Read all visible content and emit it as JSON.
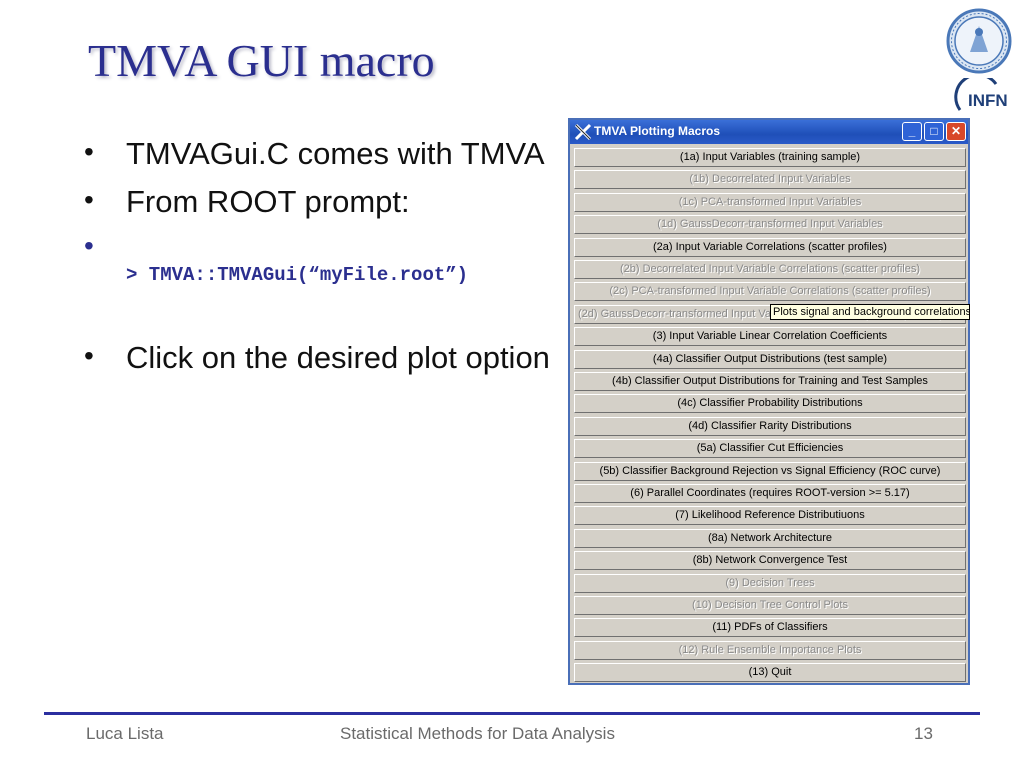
{
  "slide": {
    "title": "TMVA GUI macro",
    "bullets": [
      {
        "mark": "•",
        "text": "TMVAGui.C comes with TMVA"
      },
      {
        "mark": "•",
        "text": "From ROOT prompt:"
      },
      {
        "mark": "•",
        "text": ""
      },
      {
        "mark": "•",
        "text": "Click on the desired plot option"
      }
    ],
    "command": "> TMVA::TMVAGui(“myFile.root”)"
  },
  "logos": {
    "unina": "university-seal",
    "infn": "INFN"
  },
  "window": {
    "title": "TMVA Plotting Macros",
    "controls": {
      "minimize": "_",
      "maximize": "□",
      "close": "✕"
    },
    "buttons": [
      {
        "label": "(1a) Input Variables (training sample)",
        "enabled": true
      },
      {
        "label": "(1b) Decorrelated Input Variables",
        "enabled": false
      },
      {
        "label": "(1c) PCA-transformed Input Variables",
        "enabled": false
      },
      {
        "label": "(1d) GaussDecorr-transformed Input Variables",
        "enabled": false
      },
      {
        "label": "(2a) Input Variable Correlations (scatter profiles)",
        "enabled": true
      },
      {
        "label": "(2b) Decorrelated Input Variable Correlations (scatter profiles)",
        "enabled": false
      },
      {
        "label": "(2c) PCA-transformed Input Variable Correlations (scatter profiles)",
        "enabled": false
      },
      {
        "label": "(2d) GaussDecorr-transformed Input Variable Correlations (scatter profiles)",
        "enabled": false
      },
      {
        "label": "(3) Input Variable Linear Correlation Coefficients",
        "enabled": true
      },
      {
        "label": "(4a) Classifier Output Distributions (test sample)",
        "enabled": true
      },
      {
        "label": "(4b) Classifier Output Distributions for Training and Test Samples",
        "enabled": true
      },
      {
        "label": "(4c) Classifier Probability Distributions",
        "enabled": true
      },
      {
        "label": "(4d) Classifier Rarity Distributions",
        "enabled": true
      },
      {
        "label": "(5a) Classifier Cut Efficiencies",
        "enabled": true
      },
      {
        "label": "(5b) Classifier Background Rejection vs Signal Efficiency (ROC curve)",
        "enabled": true
      },
      {
        "label": "(6) Parallel Coordinates (requires ROOT-version >= 5.17)",
        "enabled": true
      },
      {
        "label": "(7) Likelihood Reference Distributiuons",
        "enabled": true
      },
      {
        "label": "(8a) Network Architecture",
        "enabled": true
      },
      {
        "label": "(8b) Network Convergence Test",
        "enabled": true
      },
      {
        "label": "(9) Decision Trees",
        "enabled": false
      },
      {
        "label": "(10) Decision Tree Control Plots",
        "enabled": false
      },
      {
        "label": "(11) PDFs of Classifiers",
        "enabled": true
      },
      {
        "label": "(12) Rule Ensemble Importance Plots",
        "enabled": false
      },
      {
        "label": "(13) Quit",
        "enabled": true
      }
    ],
    "tooltip": "Plots signal and background correlations"
  },
  "footer": {
    "author": "Luca Lista",
    "course": "Statistical Methods for Data Analysis",
    "page": "13"
  },
  "colors": {
    "title": "#2b2f8f",
    "rule": "#2b2fa0",
    "window_border": "#4a6fb8",
    "titlebar": "#1f4fb8",
    "button_face": "#d4d0c8"
  }
}
